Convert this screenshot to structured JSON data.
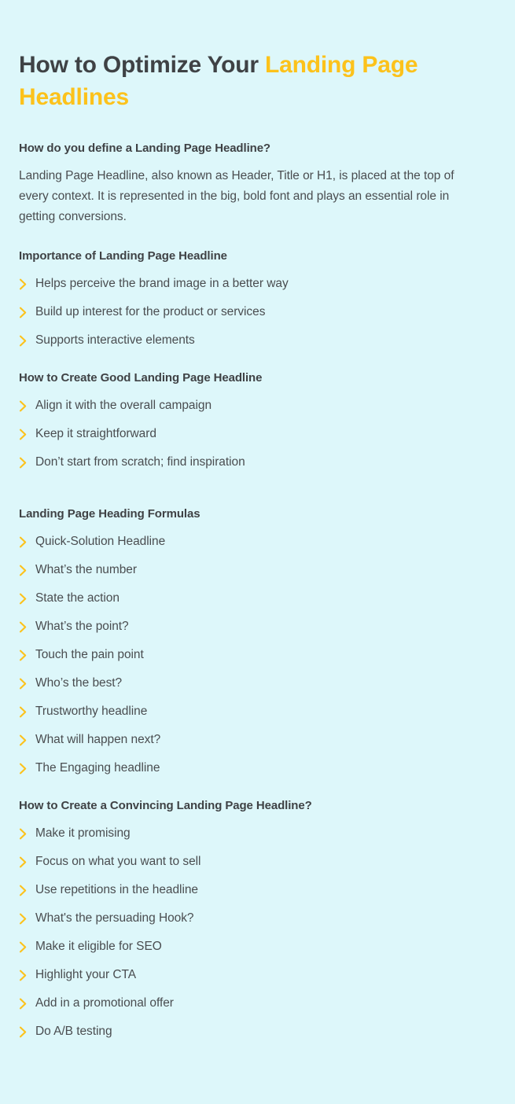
{
  "title": {
    "lead": "How to Optimize Your ",
    "accent": "Landing Page Headlines",
    "accent_color": "#fcc21b"
  },
  "colors": {
    "background": "#ddf7fa",
    "text": "#4a4d50",
    "heading": "#3f4245",
    "accent": "#fcc21b"
  },
  "icons": {
    "bullet": "chevron-right-icon"
  },
  "sections": [
    {
      "heading": "How do you define a Landing Page Headline?",
      "paragraph": "Landing Page Headline, also known as Header, Title or H1, is placed at the top of every context. It is represented in the big, bold font and plays an essential role in getting conversions.",
      "items": []
    },
    {
      "heading": "Importance of Landing Page Headline",
      "items": [
        "Helps perceive the brand image in a better way",
        "Build up interest for the product or services",
        "Supports interactive elements"
      ]
    },
    {
      "heading": "How to Create Good Landing Page Headline",
      "items": [
        "Align it with the overall campaign",
        "Keep it straightforward",
        "Don’t start from scratch; find inspiration"
      ]
    },
    {
      "heading": "Landing Page Heading Formulas",
      "items": [
        "Quick-Solution Headline",
        "What’s the number",
        "State the action",
        "What’s the point?",
        "Touch the pain point",
        "Who’s the best?",
        "Trustworthy headline",
        "What will happen next?",
        "The Engaging headline"
      ]
    },
    {
      "heading": "How to Create a Convincing Landing Page Headline?",
      "items": [
        "Make it promising",
        "Focus on what you want to sell",
        "Use repetitions in the headline",
        "What's the persuading Hook?",
        "Make it eligible for SEO",
        "Highlight your CTA",
        "Add in a promotional offer",
        "Do A/B testing"
      ]
    }
  ]
}
